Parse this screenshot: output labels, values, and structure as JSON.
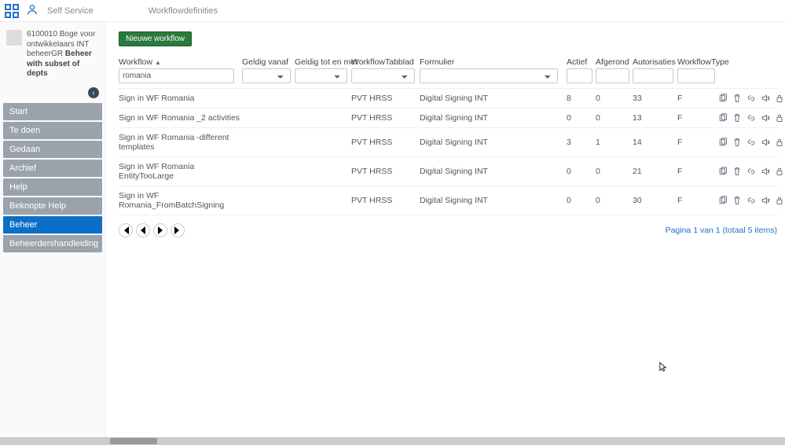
{
  "breadcrumb": {
    "root": "Self Service",
    "page": "Workflowdefinities"
  },
  "user": {
    "line1": "6100010 Boge voor",
    "line2": "ontwikkelaars INT",
    "line3a": "beheerGR ",
    "line3b": "Beheer with subset of depts"
  },
  "nav": {
    "items": [
      {
        "label": "Start",
        "active": false
      },
      {
        "label": "Te doen",
        "active": false
      },
      {
        "label": "Gedaan",
        "active": false
      },
      {
        "label": "Archief",
        "active": false
      },
      {
        "label": "Help",
        "active": false
      },
      {
        "label": "Beknopte Help",
        "active": false
      },
      {
        "label": "Beheer",
        "active": true
      },
      {
        "label": "Beheerdershandleiding",
        "active": false
      }
    ]
  },
  "toolbar": {
    "new_label": "Nieuwe workflow"
  },
  "columns": {
    "workflow": "Workflow",
    "geldig_vanaf": "Geldig vanaf",
    "geldig_tot": "Geldig tot en met",
    "tabblad": "WorkflowTabblad",
    "formulier": "Formulier",
    "actief": "Actief",
    "afgerond": "Afgerond",
    "autorisaties": "Autorisaties",
    "type": "WorkflowType"
  },
  "filters": {
    "workflow": "romania"
  },
  "rows": [
    {
      "workflow": "Sign in WF Romania",
      "tabblad": "PVT HRSS",
      "formulier": "Digital Signing INT",
      "actief": "8",
      "afgerond": "0",
      "autorisaties": "33",
      "type": "F"
    },
    {
      "workflow": "Sign in WF Romania _2 activities",
      "tabblad": "PVT HRSS",
      "formulier": "Digital Signing INT",
      "actief": "0",
      "afgerond": "0",
      "autorisaties": "13",
      "type": "F"
    },
    {
      "workflow": "Sign in WF Romania -different templates",
      "tabblad": "PVT HRSS",
      "formulier": "Digital Signing INT",
      "actief": "3",
      "afgerond": "1",
      "autorisaties": "14",
      "type": "F"
    },
    {
      "workflow": "Sign in WF Romania EntityTooLarge",
      "tabblad": "PVT HRSS",
      "formulier": "Digital Signing INT",
      "actief": "0",
      "afgerond": "0",
      "autorisaties": "21",
      "type": "F"
    },
    {
      "workflow": "Sign in WF Romania_FromBatchSigning",
      "tabblad": "PVT HRSS",
      "formulier": "Digital Signing INT",
      "actief": "0",
      "afgerond": "0",
      "autorisaties": "30",
      "type": "F"
    }
  ],
  "pager": {
    "info": "Pagina 1 van 1 (totaal 5 items)"
  }
}
